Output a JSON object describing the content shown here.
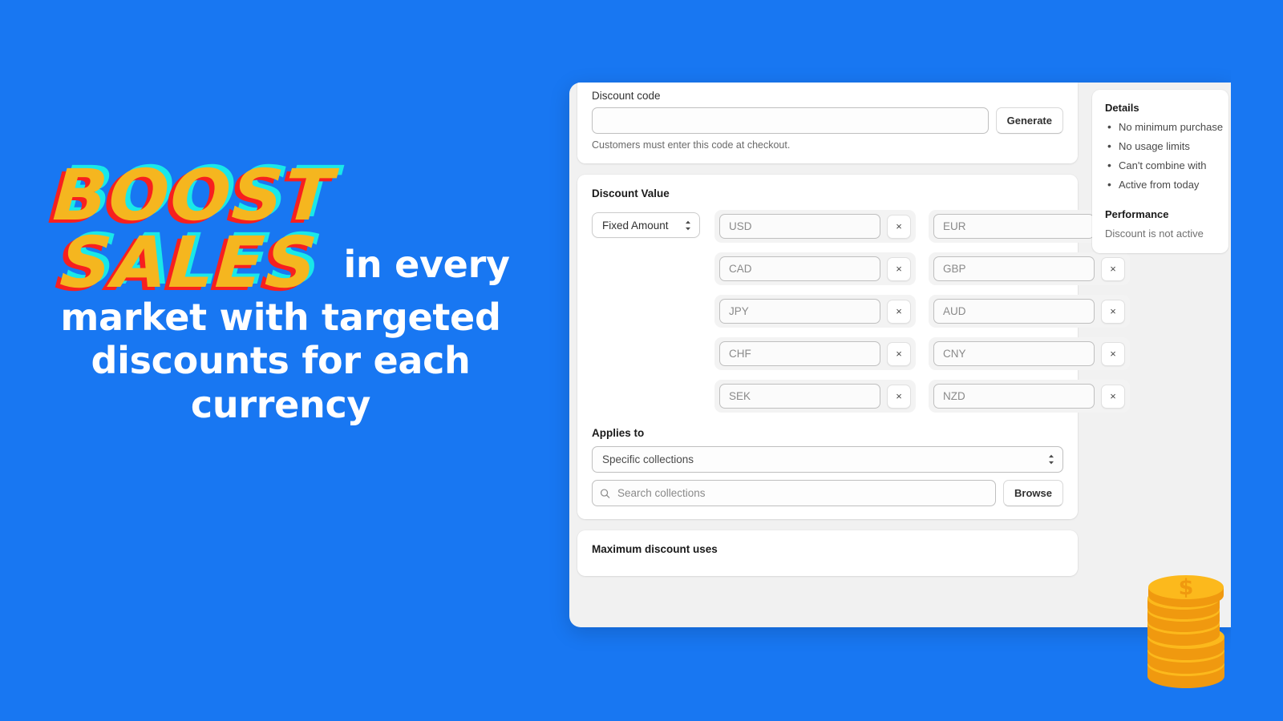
{
  "theme": {
    "background_blue": "#1877f2",
    "accent_yellow": "#f5b61f",
    "shadow_red": "#f71f1f",
    "shadow_cyan": "#19e8e8",
    "page_gray": "#f1f1f1",
    "card_white": "#ffffff"
  },
  "promo": {
    "kicker_line1": "BOOST",
    "kicker_line2": "SALES",
    "headline_inline": "in every",
    "headline_line2": "market with targeted",
    "headline_line3": "discounts for each",
    "headline_line4": "currency"
  },
  "discount_code_card": {
    "label": "Discount code",
    "input_value": "",
    "input_placeholder": "",
    "generate_label": "Generate",
    "helper": "Customers must enter this code at checkout."
  },
  "discount_value_card": {
    "title": "Discount Value",
    "type_select": {
      "selected": "Fixed Amount",
      "icon": "chevron-updown-icon"
    },
    "currency_columns": [
      {
        "rows": [
          {
            "code": "USD",
            "value": "",
            "remove_label": "×"
          },
          {
            "code": "CAD",
            "value": "",
            "remove_label": "×"
          },
          {
            "code": "JPY",
            "value": "",
            "remove_label": "×"
          },
          {
            "code": "CHF",
            "value": "",
            "remove_label": "×"
          },
          {
            "code": "SEK",
            "value": "",
            "remove_label": "×"
          }
        ]
      },
      {
        "rows": [
          {
            "code": "EUR",
            "value": "",
            "remove_label": "×"
          },
          {
            "code": "GBP",
            "value": "",
            "remove_label": "×"
          },
          {
            "code": "AUD",
            "value": "",
            "remove_label": "×"
          },
          {
            "code": "CNY",
            "value": "",
            "remove_label": "×"
          },
          {
            "code": "NZD",
            "value": "",
            "remove_label": "×"
          }
        ]
      }
    ],
    "applies_to": {
      "label": "Applies to",
      "selected": "Specific collections",
      "search_placeholder": "Search collections",
      "search_value": "",
      "search_icon": "search-icon",
      "browse_label": "Browse"
    }
  },
  "max_uses_card": {
    "title": "Maximum discount uses"
  },
  "side_panel": {
    "details_heading": "Details",
    "details_items": [
      "No minimum purchase",
      "No usage limits",
      "Can't combine with",
      "Active from today"
    ],
    "performance_heading": "Performance",
    "performance_text": "Discount is not active"
  },
  "decor": {
    "coin_symbol": "$",
    "coin_icon": "coin-stack-icon"
  }
}
